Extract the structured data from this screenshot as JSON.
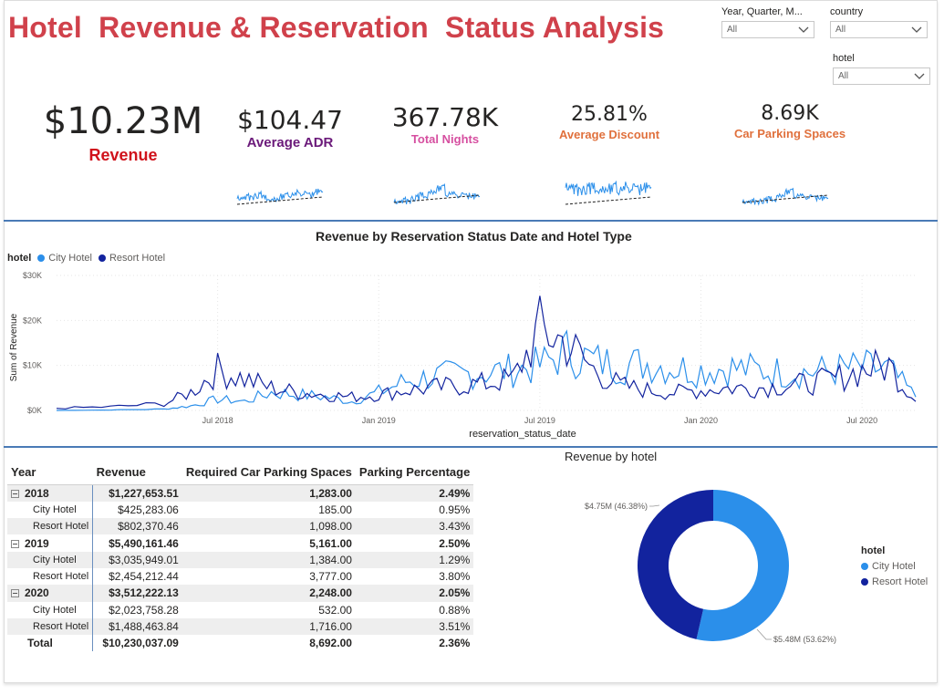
{
  "title": "Hotel  Revenue & Reservation  Status Analysis",
  "slicers": [
    {
      "label": "Year, Quarter, M...",
      "value": "All"
    },
    {
      "label": "country",
      "value": "All"
    },
    {
      "label": "hotel",
      "value": "All"
    }
  ],
  "kpis": {
    "revenue": {
      "value": "$10.23M",
      "caption": "Revenue"
    },
    "adr": {
      "value": "$104.47",
      "caption": "Average ADR"
    },
    "nights": {
      "value": "367.78K",
      "caption": "Total Nights"
    },
    "discount": {
      "value": "25.81%",
      "caption": "Average Discount"
    },
    "parking": {
      "value": "8.69K",
      "caption": "Car Parking Spaces"
    }
  },
  "colors": {
    "title": "#d0414b",
    "revenue_caption": "#d0121b",
    "adr_caption": "#6b1a7a",
    "nights_caption": "#d64fa0",
    "discount_caption": "#e0703c",
    "parking_caption": "#e0703c",
    "city_hotel": "#2b8fea",
    "resort_hotel": "#12239e",
    "divider": "#4a7ab6"
  },
  "line_chart": {
    "title": "Revenue by Reservation Status Date and Hotel Type",
    "legend_title": "hotel",
    "xlabel": "reservation_status_date",
    "ylabel": "Sum of Revenue",
    "y_ticks": [
      "$30K",
      "$20K",
      "$10K",
      "$0K"
    ],
    "x_ticks": [
      "Jul 2018",
      "Jan 2019",
      "Jul 2019",
      "Jan 2020",
      "Jul 2020"
    ]
  },
  "matrix": {
    "headers": [
      "Year",
      "Revenue",
      "Required Car Parking Spaces",
      "Parking Percentage"
    ],
    "rows": [
      {
        "kind": "grp",
        "label": "2018",
        "revenue": "$1,227,653.51",
        "parking": "1,283.00",
        "pct": "2.49%"
      },
      {
        "kind": "child",
        "label": "City Hotel",
        "revenue": "$425,283.06",
        "parking": "185.00",
        "pct": "0.95%"
      },
      {
        "kind": "child",
        "label": "Resort Hotel",
        "revenue": "$802,370.46",
        "parking": "1,098.00",
        "pct": "3.43%"
      },
      {
        "kind": "grp",
        "label": "2019",
        "revenue": "$5,490,161.46",
        "parking": "5,161.00",
        "pct": "2.50%"
      },
      {
        "kind": "child",
        "label": "City Hotel",
        "revenue": "$3,035,949.01",
        "parking": "1,384.00",
        "pct": "1.29%"
      },
      {
        "kind": "child",
        "label": "Resort Hotel",
        "revenue": "$2,454,212.44",
        "parking": "3,777.00",
        "pct": "3.80%"
      },
      {
        "kind": "grp",
        "label": "2020",
        "revenue": "$3,512,222.13",
        "parking": "2,248.00",
        "pct": "2.05%"
      },
      {
        "kind": "child",
        "label": "City Hotel",
        "revenue": "$2,023,758.28",
        "parking": "532.00",
        "pct": "0.88%"
      },
      {
        "kind": "child",
        "label": "Resort Hotel",
        "revenue": "$1,488,463.84",
        "parking": "1,716.00",
        "pct": "3.51%"
      },
      {
        "kind": "total",
        "label": "Total",
        "revenue": "$10,230,037.09",
        "parking": "8,692.00",
        "pct": "2.36%"
      }
    ]
  },
  "donut": {
    "title": "Revenue by hotel",
    "legend_title": "hotel",
    "slice_labels": {
      "city": "$5.48M (53.62%)",
      "resort": "$4.75M (46.38%)"
    }
  },
  "chart_data": [
    {
      "type": "line",
      "title": "Revenue by Reservation Status Date and Hotel Type",
      "xlabel": "reservation_status_date",
      "ylabel": "Sum of Revenue",
      "ylim": [
        0,
        30000
      ],
      "x_ticks": [
        "Jul 2018",
        "Jan 2019",
        "Jul 2019",
        "Jan 2020",
        "Jul 2020"
      ],
      "x_range": [
        "2018-01",
        "2020-09"
      ],
      "grid": true,
      "legend": "top-left",
      "series": [
        {
          "name": "City Hotel",
          "x": [
            "2018-01",
            "2018-03",
            "2018-05",
            "2018-06",
            "2018-07",
            "2018-08",
            "2018-09",
            "2018-10",
            "2018-11",
            "2018-12",
            "2019-01",
            "2019-02",
            "2019-03",
            "2019-04",
            "2019-05",
            "2019-06",
            "2019-07",
            "2019-08",
            "2019-09",
            "2019-10",
            "2019-11",
            "2019-12",
            "2020-01",
            "2020-02",
            "2020-03",
            "2020-04",
            "2020-05",
            "2020-06",
            "2020-07",
            "2020-08",
            "2020-09"
          ],
          "values": [
            0,
            100,
            300,
            1000,
            2500,
            2000,
            4000,
            3500,
            3000,
            2000,
            4000,
            6500,
            7500,
            8000,
            8500,
            9000,
            10000,
            13000,
            11000,
            10000,
            10500,
            9500,
            9000,
            9500,
            9000,
            8500,
            8500,
            9000,
            9500,
            9000,
            3000
          ]
        },
        {
          "name": "Resort Hotel",
          "x": [
            "2018-01",
            "2018-03",
            "2018-05",
            "2018-06",
            "2018-07",
            "2018-08",
            "2018-09",
            "2018-10",
            "2018-11",
            "2018-12",
            "2019-01",
            "2019-02",
            "2019-03",
            "2019-04",
            "2019-05",
            "2019-06",
            "2019-07",
            "2019-08",
            "2019-09",
            "2019-10",
            "2019-11",
            "2019-12",
            "2020-01",
            "2020-02",
            "2020-03",
            "2020-04",
            "2020-05",
            "2020-06",
            "2020-07",
            "2020-08",
            "2020-09"
          ],
          "values": [
            500,
            800,
            1500,
            4000,
            9000,
            7000,
            5000,
            4000,
            3500,
            3000,
            3500,
            4500,
            5000,
            5500,
            6000,
            7000,
            18000,
            15000,
            9000,
            5500,
            4500,
            4000,
            4500,
            5000,
            5000,
            5500,
            6000,
            7000,
            9000,
            10000,
            2000
          ]
        }
      ]
    },
    {
      "type": "pie",
      "title": "Revenue by hotel",
      "categories": [
        "City Hotel",
        "Resort Hotel"
      ],
      "values": [
        5.48,
        4.75
      ],
      "percent": [
        53.62,
        46.38
      ],
      "legend": "right"
    }
  ]
}
